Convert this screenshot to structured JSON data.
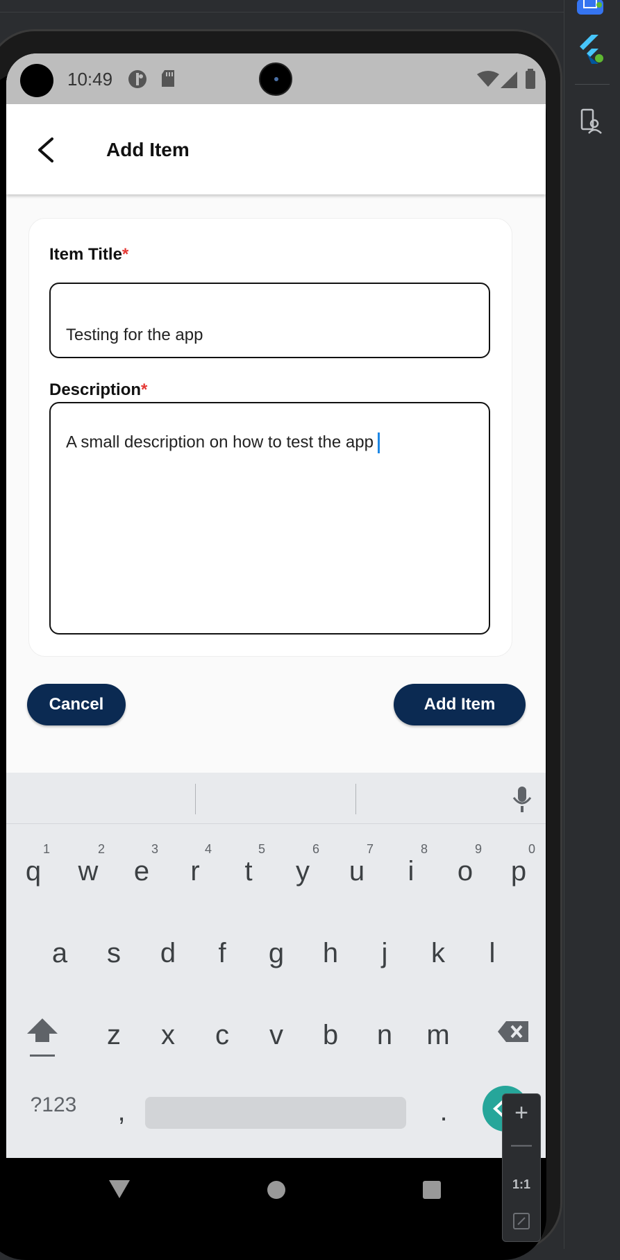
{
  "status_bar": {
    "time": "10:49"
  },
  "app_bar": {
    "title": "Add Item"
  },
  "form": {
    "title_label": "Item Title",
    "title_required": "*",
    "title_value": "Testing for the app",
    "description_label": "Description",
    "description_required": "*",
    "description_value": "A small description on how to test the app"
  },
  "actions": {
    "cancel": "Cancel",
    "add": "Add Item"
  },
  "keyboard": {
    "row1": [
      "q",
      "w",
      "e",
      "r",
      "t",
      "y",
      "u",
      "i",
      "o",
      "p"
    ],
    "row1_hints": [
      "1",
      "2",
      "3",
      "4",
      "5",
      "6",
      "7",
      "8",
      "9",
      "0"
    ],
    "row2": [
      "a",
      "s",
      "d",
      "f",
      "g",
      "h",
      "j",
      "k",
      "l"
    ],
    "row3": [
      "z",
      "x",
      "c",
      "v",
      "b",
      "n",
      "m"
    ],
    "symbols_key": "?123",
    "comma": ",",
    "period": "."
  },
  "float_toolbar": {
    "zoom_reset": "1:1"
  },
  "colors": {
    "primary": "#0b2a52",
    "required": "#e53935",
    "caret": "#1e88e5",
    "enter": "#26a69a"
  }
}
